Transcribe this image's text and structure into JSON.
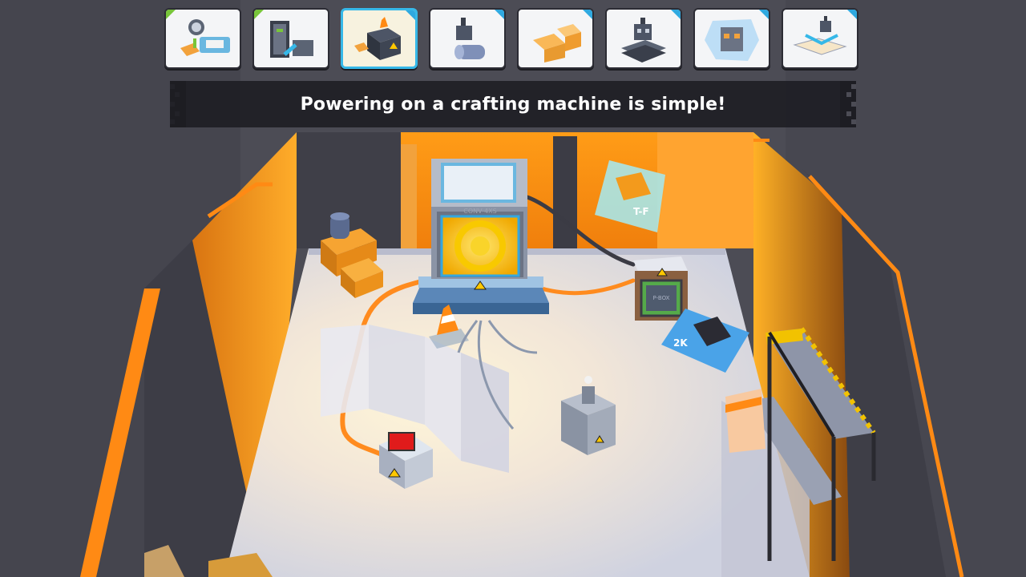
{
  "tutorial": {
    "message": "Powering on a crafting machine is simple!"
  },
  "levels": [
    {
      "name": "level-1",
      "status": "completed",
      "icon": "placement-tutorial-icon"
    },
    {
      "name": "level-2",
      "status": "completed",
      "icon": "door-grab-icon"
    },
    {
      "name": "level-3",
      "status": "current",
      "icon": "crafting-boxes-icon"
    },
    {
      "name": "level-4",
      "status": "available",
      "icon": "grabber-barrel-icon"
    },
    {
      "name": "level-5",
      "status": "available",
      "icon": "crates-icon"
    },
    {
      "name": "level-6",
      "status": "available",
      "icon": "robot-platform-icon"
    },
    {
      "name": "level-7",
      "status": "available",
      "icon": "frozen-robot-icon"
    },
    {
      "name": "level-8",
      "status": "available",
      "icon": "grabber-map-icon"
    }
  ],
  "scene_labels": {
    "machine_label": "CONV-4XS",
    "power_box_label": "P-BOX",
    "poster_right_text": "2K",
    "poster_top_text": "T-F"
  },
  "colors": {
    "accent_blue": "#36b8e8",
    "completed_green": "#78c53a",
    "warm_light": "#ff9a1a",
    "floor": "#d9dbe6",
    "wall_dark": "#3d3d46"
  }
}
